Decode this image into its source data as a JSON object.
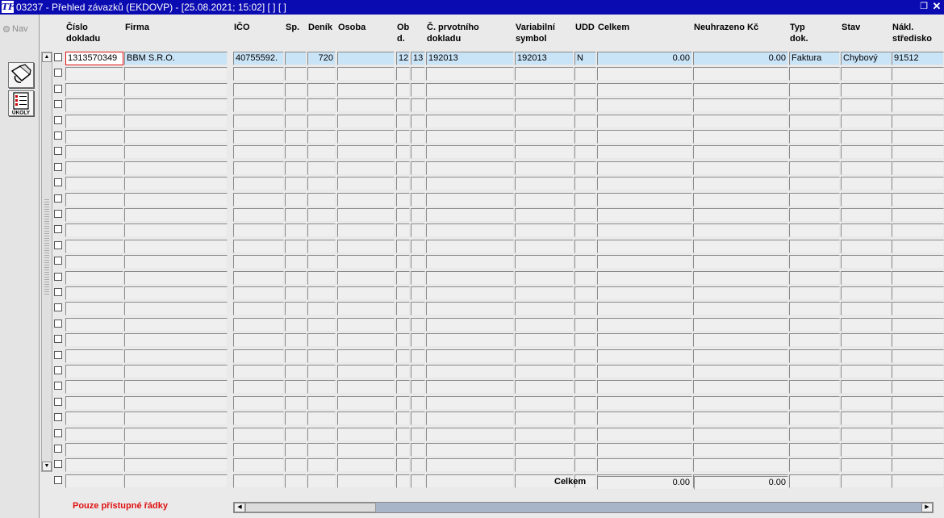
{
  "window": {
    "title": "03237 - Přehled závazků (EKDOVP) - [25.08.2021; 15:02]  [ ]  [ ]",
    "app_icon": "tf-logo-icon",
    "restore_glyph": "❐",
    "close_glyph": "✕"
  },
  "left_panel": {
    "nav_label": "Nav",
    "tool1_icon": "filter-hand-icon",
    "tool2_icon": "tasks-icon",
    "tool2_caption": "ÚKOLY"
  },
  "columns": [
    {
      "key": "cislo",
      "label": "Číslo\ndokladu"
    },
    {
      "key": "firma",
      "label": "Firma"
    },
    {
      "key": "ico",
      "label": "IČO"
    },
    {
      "key": "sp",
      "label": "Sp."
    },
    {
      "key": "denik",
      "label": "Deník"
    },
    {
      "key": "osoba",
      "label": "Osoba"
    },
    {
      "key": "obd",
      "label": "Ob\nd."
    },
    {
      "key": "x13",
      "label": ""
    },
    {
      "key": "prvotni",
      "label": "Č. prvotního\ndokladu"
    },
    {
      "key": "varsym",
      "label": "Variabilní\nsymbol"
    },
    {
      "key": "udd",
      "label": "UDD"
    },
    {
      "key": "celkem",
      "label": "Celkem"
    },
    {
      "key": "neuhrazeno",
      "label": "Neuhrazeno Kč"
    },
    {
      "key": "typ",
      "label": "Typ\ndok."
    },
    {
      "key": "stav",
      "label": "Stav"
    },
    {
      "key": "nakl",
      "label": "Nákl.\nstředisko"
    }
  ],
  "rows": [
    {
      "cislo": "1313570349",
      "firma": "BBM S.R.O.",
      "ico": "40755592.",
      "sp": "",
      "denik": "720",
      "osoba": "",
      "obd": "12",
      "x13": "13",
      "prvotni": "192013",
      "varsym": "192013",
      "udd": "N",
      "celkem": "0.00",
      "neuhrazeno": "0.00",
      "typ": "Faktura",
      "stav": "Chybový",
      "nakl": "91512"
    }
  ],
  "empty_row_count": 27,
  "totals": {
    "label": "Celkem",
    "celkem": "0.00",
    "neuhrazeno": "0.00"
  },
  "status_message": "Pouze přístupné řádky",
  "colors": {
    "titlebar": "#0b0bb2",
    "active_row": "#c9e3f7",
    "focus_border": "#e01010",
    "status_text": "#e01010"
  }
}
